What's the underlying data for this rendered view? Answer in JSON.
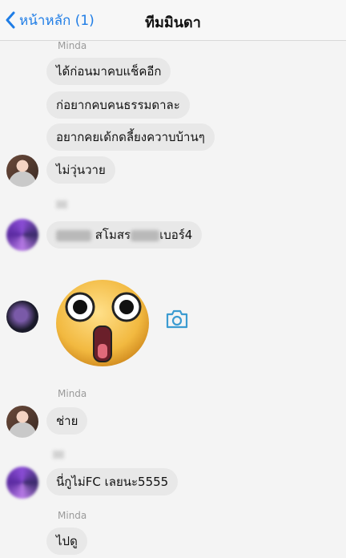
{
  "nav": {
    "back_label": "หน้าหลัก (1)",
    "title": "ทีมมินดา"
  },
  "messages": {
    "sender_minda": "Minda",
    "m1": "ได้ก่อนมาคบแช็คอีก",
    "m2": "ก่อยากคบคนธรรมดาละ",
    "m3": "อยากคยเด้กดลี้ยงควาบบ้านๆ",
    "m4": "ไม่วุ่นวาย",
    "m5_left": "",
    "m5_mid": "สโมสร",
    "m5_right": "เบอร์4",
    "m6": "ช่าย",
    "m7": "นี่กูไม่FC เลยนะ5555",
    "m8": "ไปดู"
  },
  "icons": {
    "back": "chevron-left-icon",
    "camera": "camera-icon",
    "sticker": "surprised-face-sticker"
  },
  "colors": {
    "accent": "#1f7de6",
    "bubble": "#e8e8e8",
    "background": "#f4f4f4",
    "camera": "#3b9bd1"
  }
}
